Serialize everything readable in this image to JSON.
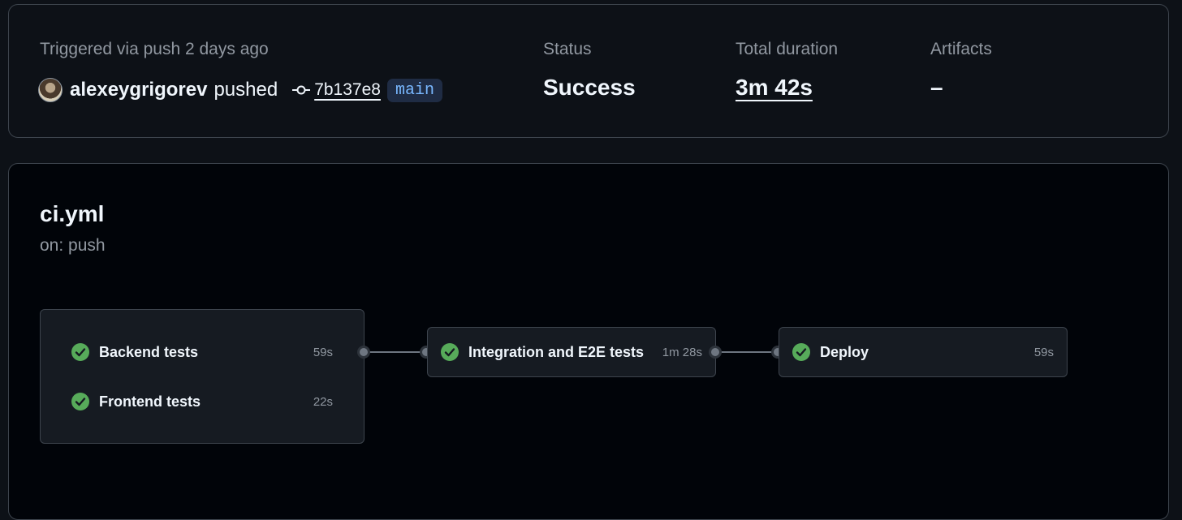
{
  "summary": {
    "trigger_text": "Triggered via push 2 days ago",
    "actor": "alexeygrigorev",
    "action": "pushed",
    "commit_sha": "7b137e8",
    "branch": "main",
    "status_label": "Status",
    "status_value": "Success",
    "duration_label": "Total duration",
    "duration_value": "3m 42s",
    "artifacts_label": "Artifacts",
    "artifacts_value": "–"
  },
  "workflow": {
    "name": "ci.yml",
    "trigger": "on: push",
    "groups": [
      {
        "jobs": [
          {
            "name": "Backend tests",
            "duration": "59s",
            "status": "success"
          },
          {
            "name": "Frontend tests",
            "duration": "22s",
            "status": "success"
          }
        ]
      },
      {
        "jobs": [
          {
            "name": "Integration and E2E tests",
            "duration": "1m 28s",
            "status": "success"
          }
        ]
      },
      {
        "jobs": [
          {
            "name": "Deploy",
            "duration": "59s",
            "status": "success"
          }
        ]
      }
    ]
  },
  "colors": {
    "success": "#57ab5a",
    "background": "#0d1117",
    "panel": "#010409",
    "branch_text": "#79b8ff"
  },
  "icons": {
    "status": "check-circle-icon",
    "commit": "git-commit-icon"
  }
}
